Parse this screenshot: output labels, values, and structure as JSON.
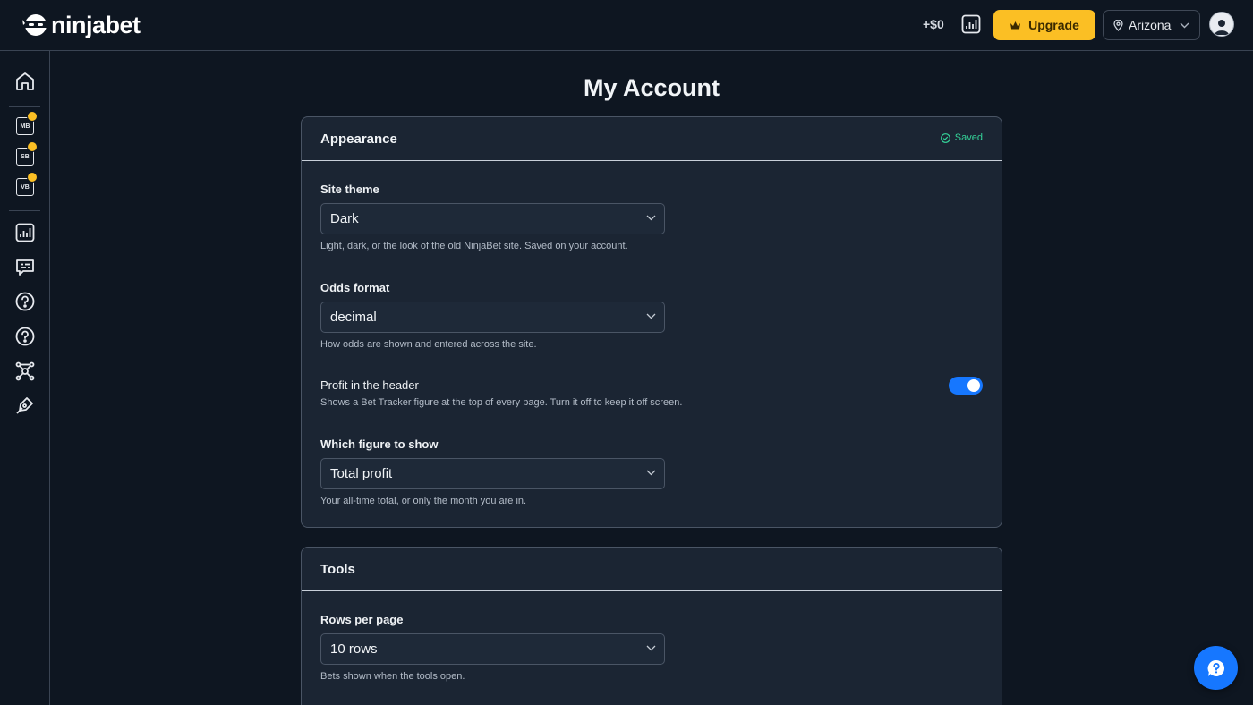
{
  "header": {
    "brand": "ninjabet",
    "profit": "+$0",
    "upgrade_label": "Upgrade",
    "state_label": "Arizona",
    "accent_color": "#fbbf24"
  },
  "sidebar": {
    "items": [
      {
        "icon": "home-icon"
      },
      {
        "icon": "mb-icon",
        "text": "MB"
      },
      {
        "icon": "sb-icon",
        "text": "SB"
      },
      {
        "icon": "vb-icon",
        "text": "VB"
      },
      {
        "icon": "chart-icon"
      },
      {
        "icon": "chat-icon"
      },
      {
        "icon": "help-icon"
      },
      {
        "icon": "help-icon"
      },
      {
        "icon": "network-icon"
      },
      {
        "icon": "pen-icon"
      }
    ]
  },
  "main": {
    "page_title": "My Account",
    "appearance": {
      "title": "Appearance",
      "status": "Saved",
      "site_theme": {
        "label": "Site theme",
        "value": "Dark",
        "help": "Light, dark, or the look of the old NinjaBet site. Saved on your account."
      },
      "odds_format": {
        "label": "Odds format",
        "value": "decimal",
        "help": "How odds are shown and entered across the site."
      },
      "profit_header": {
        "label": "Profit in the header",
        "help": "Shows a Bet Tracker figure at the top of every page. Turn it off to keep it off screen.",
        "enabled": true
      },
      "figure": {
        "label": "Which figure to show",
        "value": "Total profit",
        "help": "Your all-time total, or only the month you are in."
      }
    },
    "tools": {
      "title": "Tools",
      "rows_per_page": {
        "label": "Rows per page",
        "value": "10 rows",
        "help": "Bets shown when the tools open."
      }
    }
  }
}
